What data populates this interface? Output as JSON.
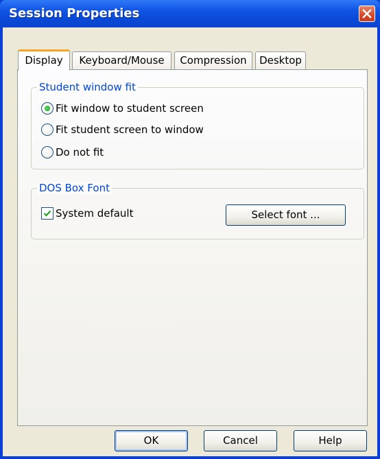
{
  "window": {
    "title": "Session Properties"
  },
  "tabs": [
    {
      "label": "Display",
      "active": true
    },
    {
      "label": "Keyboard/Mouse",
      "active": false
    },
    {
      "label": "Compression",
      "active": false
    },
    {
      "label": "Desktop",
      "active": false
    }
  ],
  "student_window_fit": {
    "label": "Student window fit",
    "options": [
      {
        "label": "Fit window to student screen",
        "selected": true
      },
      {
        "label": "Fit student screen to window",
        "selected": false
      },
      {
        "label": "Do not fit",
        "selected": false
      }
    ]
  },
  "dos_box_font": {
    "label": "DOS Box Font",
    "system_default": {
      "label": "System default",
      "checked": true
    },
    "select_font_button": "Select font ..."
  },
  "footer": {
    "ok": "OK",
    "cancel": "Cancel",
    "help": "Help"
  },
  "colors": {
    "title_bar": "#0a49d6",
    "group_label": "#0046d5",
    "active_tab_accent": "#f5a623",
    "radio_selected": "#21a121",
    "close_button": "#d6492b"
  }
}
